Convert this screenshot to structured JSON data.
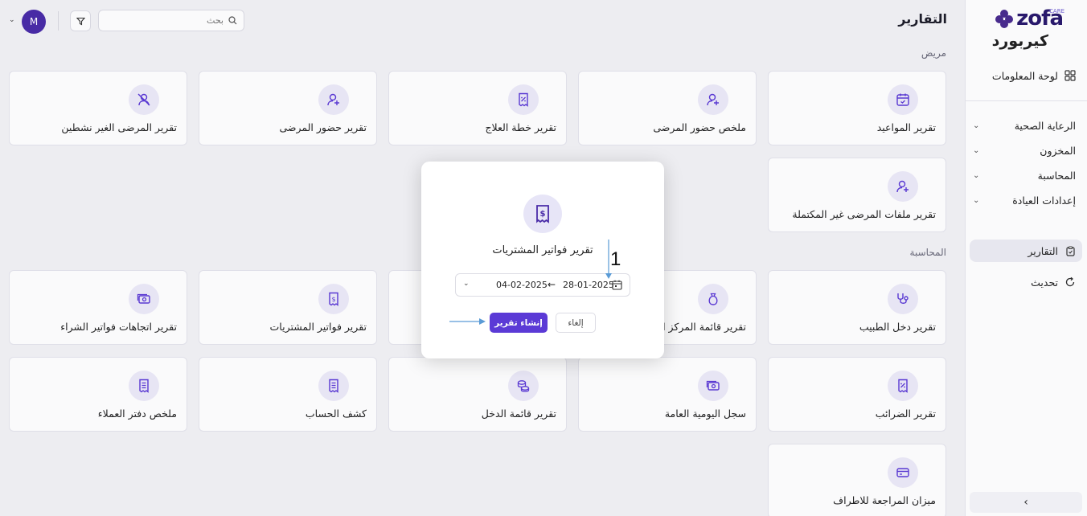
{
  "app": {
    "logo_text": "zofa",
    "logo_sub": "CARE",
    "brand_name": "كيربورد"
  },
  "sidebar": {
    "dashboard": "لوحة المعلومات",
    "groups": [
      {
        "label": "الرعاية الصحية"
      },
      {
        "label": "المخزون"
      },
      {
        "label": "المحاسبة"
      },
      {
        "label": "إعدادات العيادة"
      }
    ],
    "reports": "التقارير",
    "update": "تحديث"
  },
  "header": {
    "title": "التقارير",
    "search_placeholder": "بحث",
    "avatar_initial": "M"
  },
  "sections": {
    "patient": "مريض",
    "accounting": "المحاسبة"
  },
  "patient_cards": [
    {
      "label": "تقرير المواعيد",
      "icon": "calendar-check-icon"
    },
    {
      "label": "ملخص حضور المرضى",
      "icon": "user-plus-icon"
    },
    {
      "label": "تقرير خطة العلاج",
      "icon": "receipt-percent-icon"
    },
    {
      "label": "تقرير حضور المرضى",
      "icon": "user-plus-icon"
    },
    {
      "label": "تقرير المرضى الغير نشطين",
      "icon": "user-off-icon"
    },
    {
      "label": "تقرير ملفات المرضى غير المكتملة",
      "icon": "user-plus-icon"
    }
  ],
  "accounting_cards": [
    {
      "label": "تقرير دخل الطبيب",
      "icon": "stethoscope-icon"
    },
    {
      "label": "تقرير قائمة المركز ال",
      "icon": "money-bag-icon"
    },
    {
      "label": "تقرير فواتير المشتريات",
      "icon": "dollar-receipt-icon"
    },
    {
      "label": "تقرير اتجاهات فواتير الشراء",
      "icon": "cash-icon"
    },
    {
      "label": "تقرير الضرائب",
      "icon": "receipt-percent-icon"
    },
    {
      "label": "سجل اليومية العامة",
      "icon": "cash-icon"
    },
    {
      "label": "تقرير قائمة الدخل",
      "icon": "coins-icon"
    },
    {
      "label": "كشف الحساب",
      "icon": "document-list-icon"
    },
    {
      "label": "ملخص دفتر العملاء",
      "icon": "document-list-icon"
    },
    {
      "label": "ميزان المراجعة للاطراف",
      "icon": "credit-card-icon"
    }
  ],
  "modal": {
    "title": "تقرير فواتير المشتريات",
    "date_from": "28-01-2025",
    "date_to": "04-02-2025",
    "arrow": "←",
    "create_button": "إنشاء تقرير",
    "cancel_button": "إلغاء"
  },
  "annotation": {
    "step_number": "1"
  },
  "colors": {
    "primary": "#5b3ad6",
    "avatar": "#4a2ca8",
    "icon_bg": "#eceaf8",
    "annotation_arrow": "#5a9bd6"
  }
}
